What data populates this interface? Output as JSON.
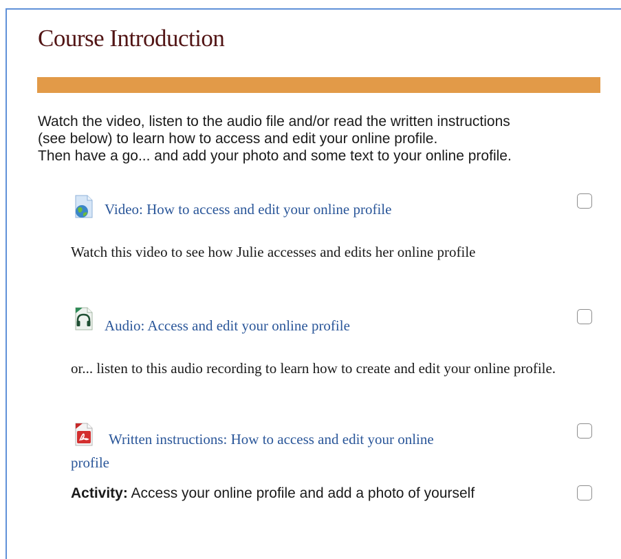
{
  "section": {
    "title": "Course Introduction",
    "accent_color": "#e29a48",
    "intro_lines": [
      "Watch the video, listen to the audio file and/or read the written instructions",
      "(see below) to learn how to access and edit your online profile.",
      "Then have a go... and add your photo and some text to your online profile."
    ]
  },
  "items": [
    {
      "type": "video",
      "icon": "globe-file-icon",
      "link": "Video: How to access and edit your online profile",
      "description": "Watch this video to see how Julie accesses and edits her online profile",
      "completed": false
    },
    {
      "type": "audio",
      "icon": "headphones-file-icon",
      "link": "Audio: Access and edit your online profile",
      "description": "or... listen to this audio recording to learn how to create and edit your online profile.",
      "completed": false
    },
    {
      "type": "pdf",
      "icon": "pdf-file-icon",
      "link_line1": "Written instructions: How to access and edit your online",
      "link_line2": "profile",
      "completed": false
    }
  ],
  "activity": {
    "label": "Activity:",
    "text": " Access your online profile and add a photo of yourself",
    "completed": false
  }
}
